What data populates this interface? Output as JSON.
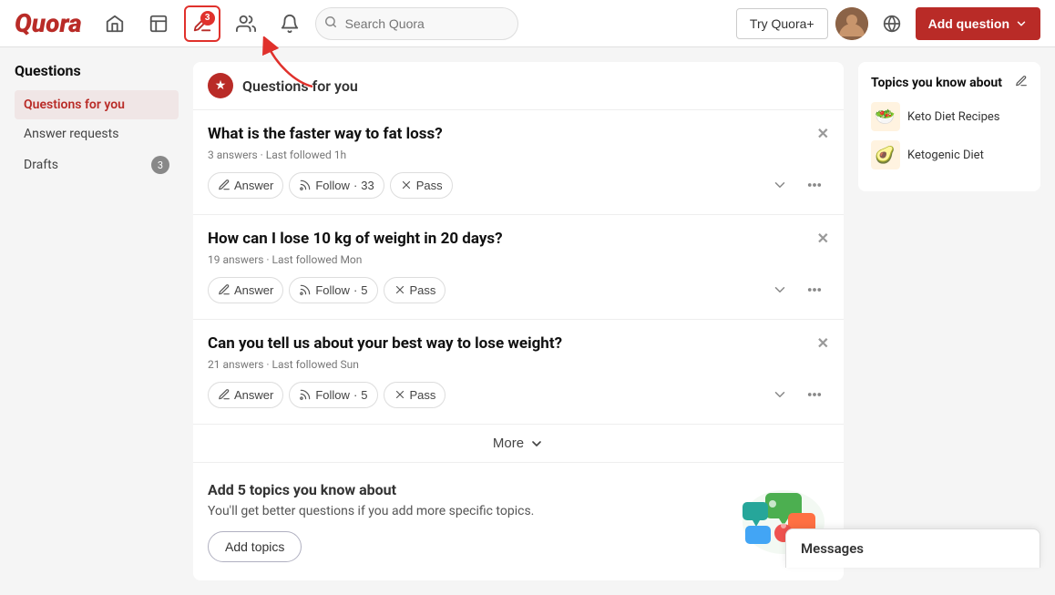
{
  "navbar": {
    "logo": "Quora",
    "search_placeholder": "Search Quora",
    "badge_count": "3",
    "try_quora_label": "Try Quora+",
    "add_question_label": "Add question",
    "globe_label": "Language"
  },
  "sidebar": {
    "section_title": "Questions",
    "items": [
      {
        "id": "questions-for-you",
        "label": "Questions for you",
        "active": true,
        "badge": null
      },
      {
        "id": "answer-requests",
        "label": "Answer requests",
        "active": false,
        "badge": null
      },
      {
        "id": "drafts",
        "label": "Drafts",
        "active": false,
        "badge": "3"
      }
    ]
  },
  "main": {
    "header_title": "Questions for you",
    "questions": [
      {
        "id": "q1",
        "title": "What is the faster way to fat loss?",
        "meta": "3 answers · Last followed 1h",
        "follow_count": "33"
      },
      {
        "id": "q2",
        "title": "How can I lose 10 kg of weight in 20 days?",
        "meta": "19 answers · Last followed Mon",
        "follow_count": "5"
      },
      {
        "id": "q3",
        "title": "Can you tell us about your best way to lose weight?",
        "meta": "21 answers · Last followed Sun",
        "follow_count": "5"
      }
    ],
    "action_labels": {
      "answer": "Answer",
      "follow": "Follow",
      "pass": "Pass",
      "more": "More"
    },
    "add_topics": {
      "title": "Add 5 topics you know about",
      "description": "You'll get better questions if you add more specific topics.",
      "button_label": "Add topics"
    }
  },
  "right_panel": {
    "title": "Topics you know about",
    "topics": [
      {
        "name": "Keto Diet Recipes",
        "color": "#e67e22"
      },
      {
        "name": "Ketogenic Diet",
        "color": "#e67e22"
      }
    ]
  },
  "messages": {
    "label": "Messages"
  }
}
